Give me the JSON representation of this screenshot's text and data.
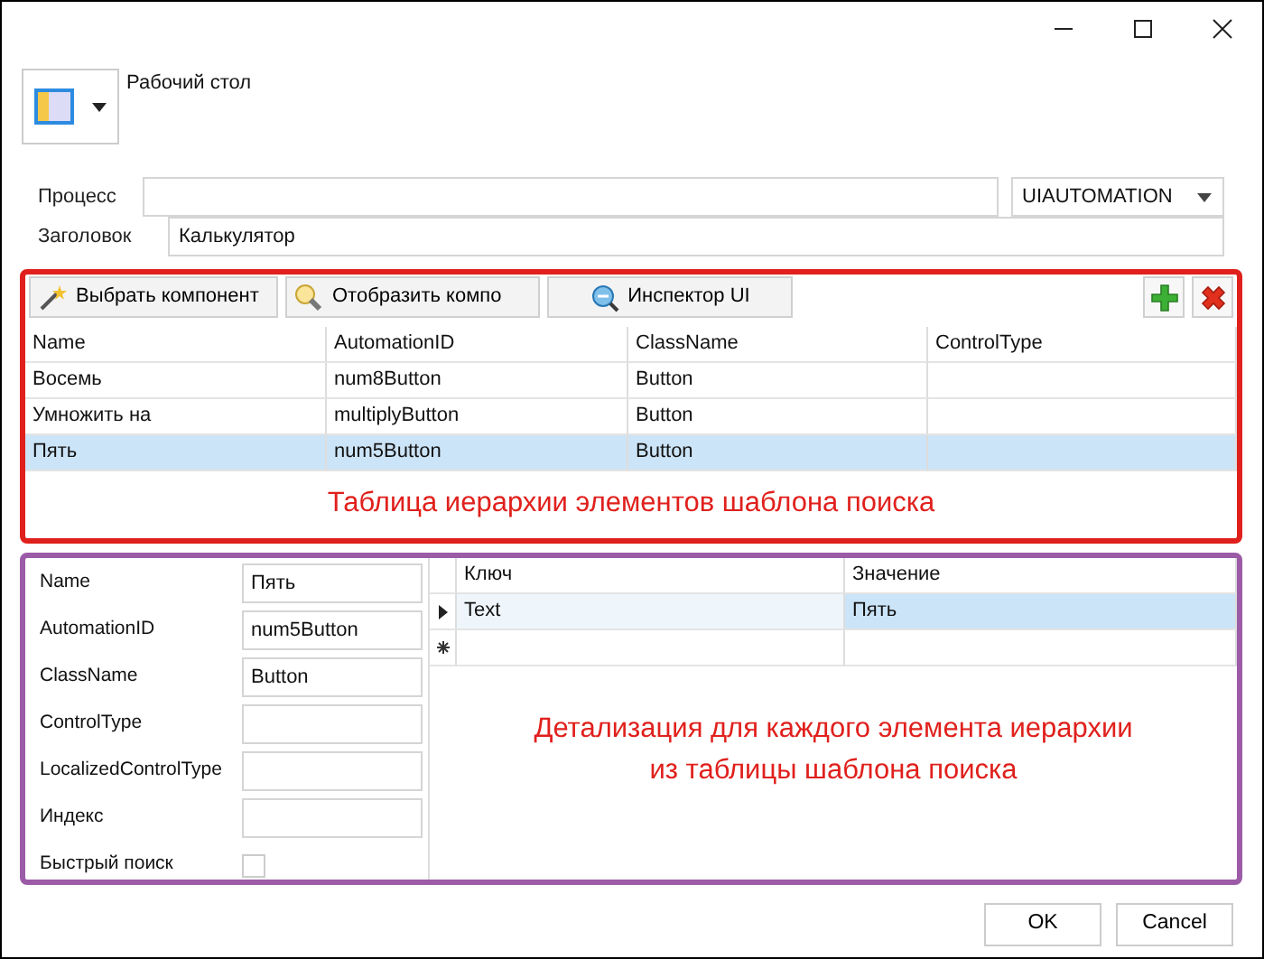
{
  "desktop": {
    "label": "Рабочий стол"
  },
  "process": {
    "label": "Процесс"
  },
  "engine_select": {
    "value": "UIAUTOMATION"
  },
  "title_field": {
    "label": "Заголовок",
    "value": "Калькулятор"
  },
  "hierarchy": {
    "toolbar": [
      {
        "label": "Выбрать компонент",
        "kind": "wand"
      },
      {
        "label": "Отобразить компо",
        "kind": "lamp"
      },
      {
        "label": "Инспектор UI",
        "kind": "inspector"
      }
    ],
    "columns": [
      "Name",
      "AutomationID",
      "ClassName",
      "ControlType"
    ],
    "rows": [
      {
        "cells": [
          "Восемь",
          "num8Button",
          "Button"
        ],
        "selected": false
      },
      {
        "cells": [
          "Умножить на",
          "multiplyButton",
          "Button"
        ],
        "selected": false
      },
      {
        "cells": [
          "Пять",
          "num5Button",
          "Button"
        ],
        "selected": true
      }
    ],
    "caption": "Таблица иерархии элементов шаблона поиска"
  },
  "details": {
    "fields": [
      {
        "label": "Name",
        "kind": "text",
        "value": "Пять"
      },
      {
        "label": "AutomationID",
        "kind": "text",
        "value": "num5Button"
      },
      {
        "label": "ClassName",
        "kind": "text",
        "value": "Button"
      },
      {
        "label": "ControlType",
        "kind": "text"
      },
      {
        "label": "LocalizedControlType",
        "kind": "text"
      },
      {
        "label": "Индекс",
        "kind": "text"
      },
      {
        "label": "Быстрый поиск",
        "kind": "checkbox",
        "checked": false
      }
    ],
    "grid": {
      "columns": [
        "Ключ",
        "Значение"
      ],
      "rows": [
        {
          "key": "Text",
          "value": "Пять",
          "current": true
        }
      ],
      "new_row": true
    },
    "caption": [
      "Детализация для каждого элемента иерархии",
      "из таблицы шаблона поиска"
    ]
  },
  "buttons": [
    "OK",
    "Cancel"
  ]
}
